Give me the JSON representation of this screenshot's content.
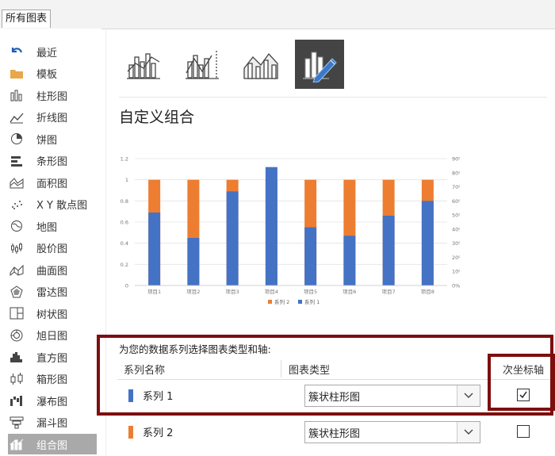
{
  "tab": {
    "label": "所有图表"
  },
  "sidebar": {
    "items": [
      {
        "label": "最近",
        "icon": "undo-arrow-icon"
      },
      {
        "label": "模板",
        "icon": "folder-icon"
      },
      {
        "label": "柱形图",
        "icon": "column-chart-icon"
      },
      {
        "label": "折线图",
        "icon": "line-chart-icon"
      },
      {
        "label": "饼图",
        "icon": "pie-chart-icon"
      },
      {
        "label": "条形图",
        "icon": "bar-chart-icon"
      },
      {
        "label": "面积图",
        "icon": "area-chart-icon"
      },
      {
        "label": "X Y 散点图",
        "icon": "scatter-chart-icon"
      },
      {
        "label": "地图",
        "icon": "globe-icon"
      },
      {
        "label": "股价图",
        "icon": "stock-chart-icon"
      },
      {
        "label": "曲面图",
        "icon": "surface-chart-icon"
      },
      {
        "label": "雷达图",
        "icon": "radar-chart-icon"
      },
      {
        "label": "树状图",
        "icon": "treemap-icon"
      },
      {
        "label": "旭日图",
        "icon": "sunburst-icon"
      },
      {
        "label": "直方图",
        "icon": "histogram-icon"
      },
      {
        "label": "箱形图",
        "icon": "boxplot-icon"
      },
      {
        "label": "瀑布图",
        "icon": "waterfall-icon"
      },
      {
        "label": "漏斗图",
        "icon": "funnel-icon"
      },
      {
        "label": "组合图",
        "icon": "combo-chart-icon"
      }
    ],
    "active_index": 18
  },
  "main": {
    "title": "自定义组合",
    "section_title": "为您的数据系列选择图表类型和轴:",
    "headers": {
      "name": "系列名称",
      "type": "图表类型",
      "axis": "次坐标轴"
    },
    "series_rows": [
      {
        "name": "系列 1",
        "color": "#4472c4",
        "type": "簇状柱形图",
        "secondary_axis": true
      },
      {
        "name": "系列 2",
        "color": "#ed7d31",
        "type": "簇状柱形图",
        "secondary_axis": false
      }
    ]
  },
  "colors": {
    "series1": "#4472c4",
    "series2": "#ed7d31",
    "highlight": "#7e0e0e",
    "selected_bg": "#a9a9a9"
  },
  "chart_data": {
    "type": "bar",
    "categories": [
      "项目1",
      "项目2",
      "项目3",
      "项目4",
      "项目5",
      "项目6",
      "项目7",
      "项目8"
    ],
    "series": [
      {
        "name": "系列 1",
        "values": [
          0.69,
          0.45,
          0.89,
          1.12,
          0.55,
          0.47,
          0.66,
          0.8
        ],
        "axis": "primary"
      },
      {
        "name": "系列 2",
        "values": [
          1.0,
          1.0,
          1.0,
          1.0,
          1.0,
          1.0,
          1.0,
          1.0
        ],
        "axis": "secondary"
      }
    ],
    "ylim": [
      0,
      1.2
    ],
    "y_ticks": [
      "0",
      "0.2",
      "0.4",
      "0.6",
      "0.8",
      "1",
      "1.2"
    ],
    "y2lim": [
      0,
      0.9
    ],
    "y2_ticks": [
      "0%",
      "10%",
      "20%",
      "30%",
      "40%",
      "50%",
      "60%",
      "70%",
      "80%",
      "90%"
    ],
    "legend": [
      "系列 2",
      "系列 1"
    ],
    "legend_position": "bottom"
  }
}
